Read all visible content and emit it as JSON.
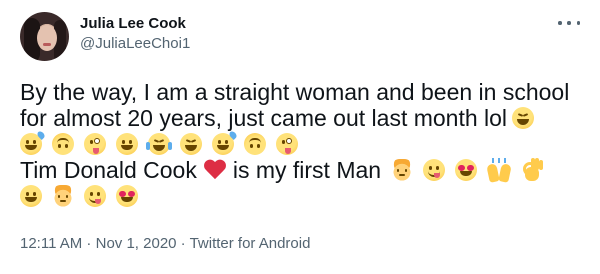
{
  "author": {
    "display_name": "Julia Lee Cook",
    "handle": "@JuliaLeeChoi1"
  },
  "tweet": {
    "line1": "By the way, I am a straight woman and been in school",
    "line2": "for almost 20 years, just came out last month lol",
    "line4a": "Tim Donald Cook",
    "line4b": "is my first Man",
    "emojis_line2_end": [
      "grinning-squinting-face"
    ],
    "emojis_line3": [
      "grinning-face-with-sweat",
      "upside-down-face",
      "winking-face-with-tongue",
      "grinning-face",
      "face-with-tears-of-joy",
      "grinning-squinting-face",
      "grinning-face-with-sweat",
      "upside-down-face",
      "winking-face-with-tongue"
    ],
    "emojis_line4": [
      "red-heart",
      "person-blond-hair",
      "face-savoring-food",
      "smiling-face-with-heart-eyes",
      "raising-hands",
      "ok-hand"
    ],
    "emojis_line5": [
      "grinning-face-with-big-eyes",
      "person-blond-hair",
      "face-savoring-food",
      "smiling-face-with-heart-eyes"
    ]
  },
  "meta": {
    "time": "12:11 AM",
    "sep1": " · ",
    "date": "Nov 1, 2020",
    "sep2": " · ",
    "source": "Twitter for Android"
  },
  "colors": {
    "text": "#0f1419",
    "secondary": "#536471",
    "heart": "#dd2e44"
  }
}
